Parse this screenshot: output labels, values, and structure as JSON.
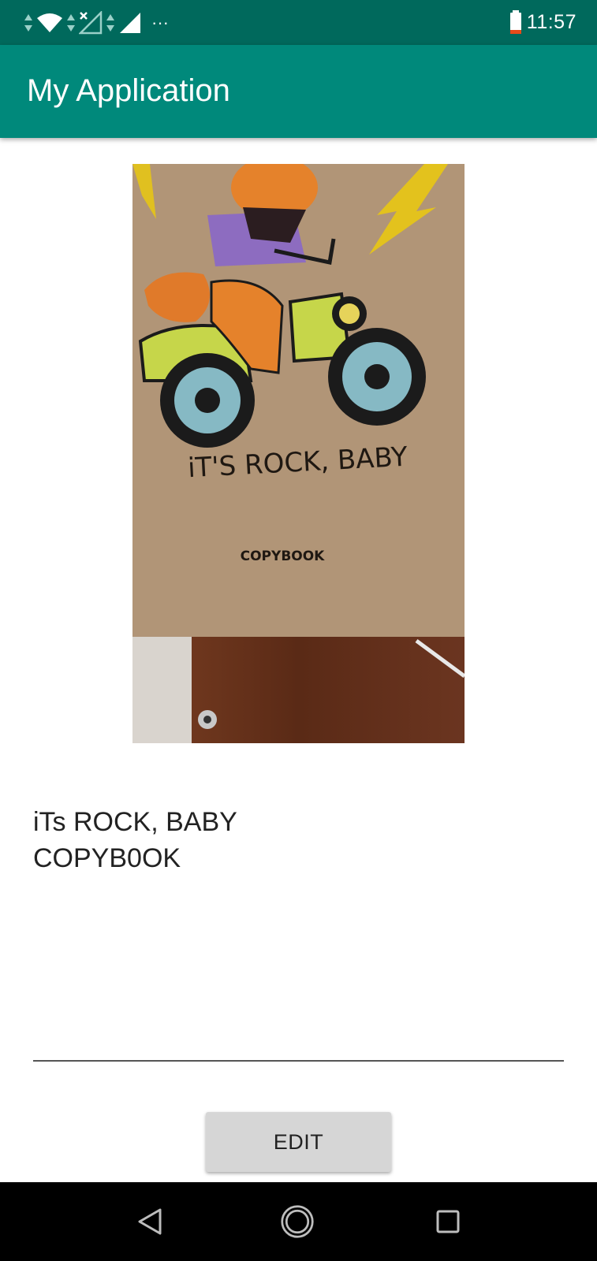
{
  "status_bar": {
    "time": "11:57",
    "overflow": "···",
    "icons": [
      "data-arrows-icon",
      "wifi-icon",
      "no-signal-icon",
      "signal-icon",
      "battery-icon"
    ]
  },
  "app_bar": {
    "title": "My Application"
  },
  "photo": {
    "caption_line1": "iT'S ROCK, BABY",
    "caption_line2": "COPYBOOK"
  },
  "result": {
    "text": "iTs ROCK, BABY\nCOPYB0OK"
  },
  "actions": {
    "edit_label": "EDIT"
  },
  "nav": {
    "icons": [
      "back-icon",
      "home-icon",
      "recents-icon"
    ]
  },
  "colors": {
    "status_bar": "#00695c",
    "app_bar": "#00897b",
    "button": "#d6d6d6"
  }
}
